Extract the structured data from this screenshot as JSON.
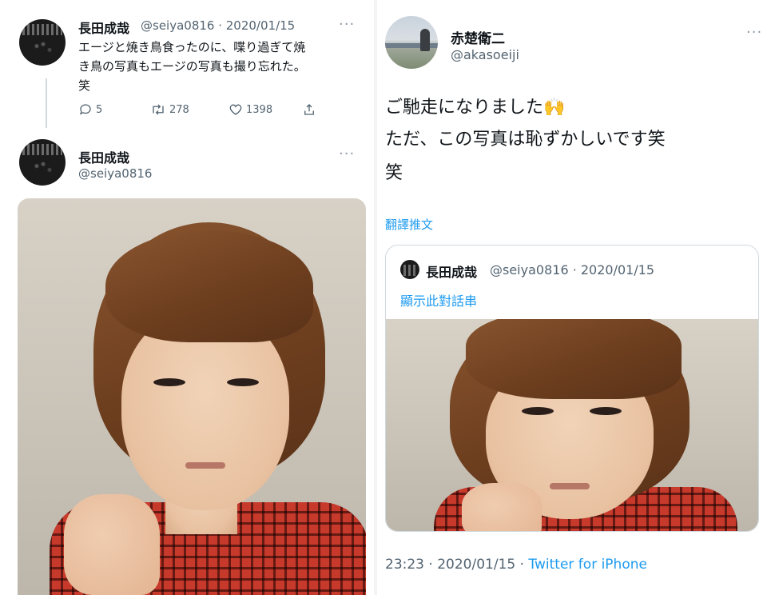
{
  "left_tweet": {
    "author_name": "長田成哉",
    "meta": "@seiya0816 · 2020/01/15",
    "more": "···",
    "text_lines": [
      "エージと焼き鳥食ったのに、喋り過ぎて焼",
      "き鳥の写真もエージの写真も撮り忘れた。",
      "笑"
    ],
    "actions": {
      "replies": "5",
      "retweets": "278",
      "likes": "1398"
    }
  },
  "left_reply": {
    "author_name": "長田成哉",
    "handle": "@seiya0816",
    "more": "···"
  },
  "right_tweet": {
    "author_name": "赤楚衛二",
    "handle": "@akasoeiji",
    "more": "···",
    "text_lines": [
      "ご馳走になりました🙌",
      "ただ、この写真は恥ずかしいです笑",
      "笑"
    ],
    "translate_label": "翻譯推文",
    "quote": {
      "author_name": "長田成哉",
      "meta": "@seiya0816 · 2020/01/15",
      "show_thread": "顯示此對話串"
    },
    "footer": {
      "time": "23:23",
      "sep1": "·",
      "date": "2020/01/15",
      "sep2": "·",
      "client": "Twitter for iPhone"
    }
  },
  "colors": {
    "link_blue": "#1d9bf0",
    "secondary_gray": "#536471",
    "border_gray": "#cfd9de"
  },
  "icons": {
    "reply": "reply-icon",
    "retweet": "retweet-icon",
    "like": "heart-icon",
    "share": "share-icon"
  }
}
